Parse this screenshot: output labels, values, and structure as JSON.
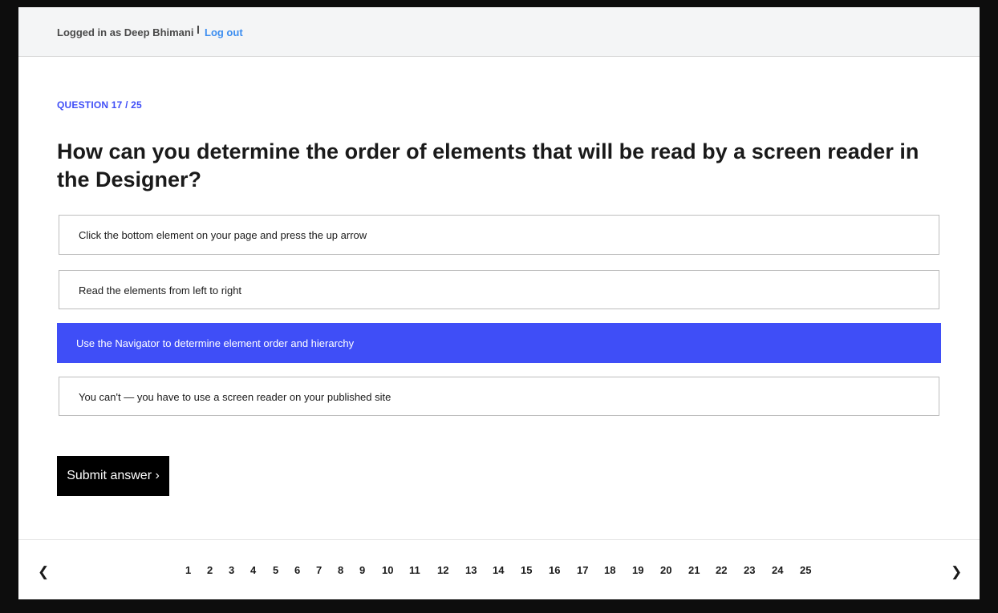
{
  "header": {
    "logged_in_text": "Logged in as Deep Bhimani",
    "logout_label": "Log out"
  },
  "question": {
    "counter": "QUESTION 17 / 25",
    "text": "How can you determine the order of elements that will be read by a screen reader in the Designer?",
    "options": [
      {
        "label": "Click the bottom element on your page and press the up arrow",
        "selected": false
      },
      {
        "label": "Read the elements from left to right",
        "selected": false
      },
      {
        "label": "Use the Navigator to determine element order and hierarchy",
        "selected": true
      },
      {
        "label": "You can't — you have to use a screen reader on your published site",
        "selected": false
      }
    ]
  },
  "submit_label": "Submit answer ›",
  "pagination": {
    "prev_label": "❮",
    "next_label": "❯",
    "pages": [
      "1",
      "2",
      "3",
      "4",
      "5",
      "6",
      "7",
      "8",
      "9",
      "10",
      "11",
      "12",
      "13",
      "14",
      "15",
      "16",
      "17",
      "18",
      "19",
      "20",
      "21",
      "22",
      "23",
      "24",
      "25"
    ]
  },
  "colors": {
    "accent": "#3f4ef7",
    "link": "#3d8ef0",
    "button_bg": "#000000"
  }
}
